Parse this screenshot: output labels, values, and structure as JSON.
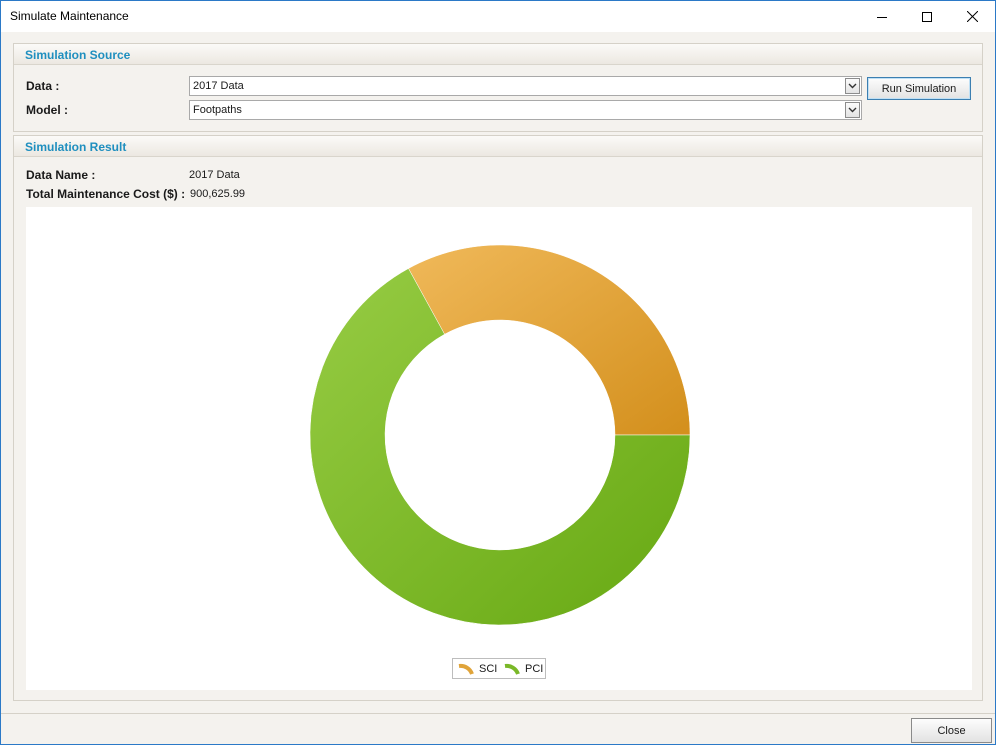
{
  "window": {
    "title": "Simulate Maintenance",
    "controls": {
      "minimize": "minimize-icon",
      "maximize": "maximize-icon",
      "close": "close-icon"
    }
  },
  "source": {
    "heading": "Simulation Source",
    "data_label": "Data :",
    "data_value": "2017 Data",
    "model_label": "Model :",
    "model_value": "Footpaths",
    "run_button": "Run Simulation"
  },
  "result": {
    "heading": "Simulation Result",
    "data_name_label": "Data Name :",
    "data_name_value": "2017 Data",
    "cost_label": "Total Maintenance Cost ($) :",
    "cost_value": "900,625.99"
  },
  "chart_data": {
    "type": "pie",
    "variant": "donut",
    "series": [
      {
        "name": "SCI",
        "value": 33,
        "color": "#e0a43a"
      },
      {
        "name": "PCI",
        "value": 67,
        "color": "#7ab828"
      }
    ],
    "legend": {
      "placement": "bottom-center"
    }
  },
  "footer": {
    "close_button": "Close"
  },
  "colors": {
    "accent_heading": "#1f8fbf",
    "window_border": "#2b79c7",
    "sci": "#e0a43a",
    "pci": "#7ab828"
  }
}
